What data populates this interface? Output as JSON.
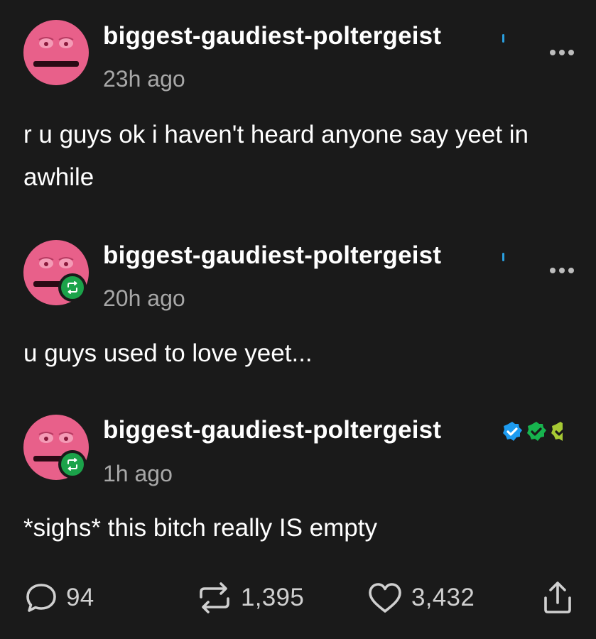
{
  "thread": [
    {
      "username": "biggest-gaudiest-poltergeist",
      "time": "23h ago",
      "text": "r u guys ok i haven't heard anyone say yeet in awhile",
      "reblogged": false
    },
    {
      "username": "biggest-gaudiest-poltergeist",
      "time": "20h ago",
      "text": "u guys used to love yeet...",
      "reblogged": true
    },
    {
      "username": "biggest-gaudiest-poltergeist",
      "time": "1h ago",
      "text": "*sighs* this bitch really IS empty",
      "reblogged": true
    }
  ],
  "notes": {
    "replies": "94",
    "reblogs": "1,395",
    "likes": "3,432"
  },
  "colors": {
    "background": "#1a1a1a",
    "avatar_pink": "#e8608a",
    "reblog_green": "#1ba34a",
    "verified_blue": "#1d9bf0",
    "verified_green": "#17b34e",
    "muted_text": "#a8a8a8"
  },
  "icons": {
    "post_menu": "more-dots-icon",
    "reply": "speech-bubble-icon",
    "reblog": "reblog-arrows-icon",
    "like": "heart-outline-icon",
    "share": "share-upload-icon"
  }
}
